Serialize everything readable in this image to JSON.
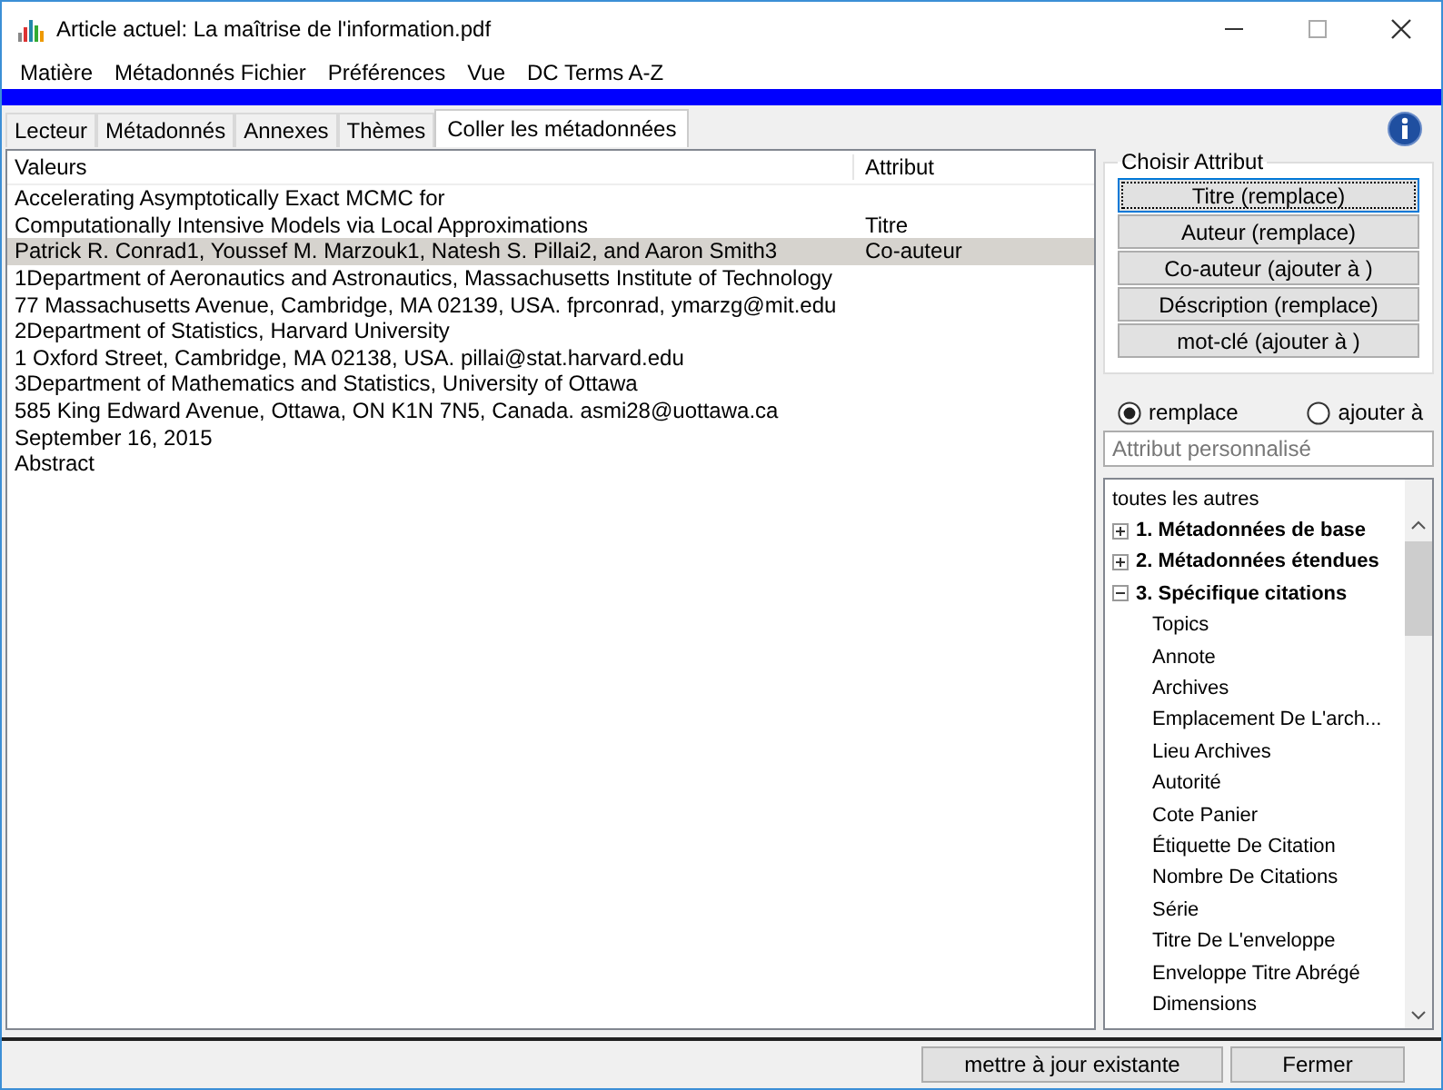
{
  "window": {
    "title": "Article actuel: La maîtrise de l'information.pdf"
  },
  "menu": [
    "Matière",
    "Métadonnés Fichier",
    "Préférences",
    "Vue",
    "DC Terms A-Z"
  ],
  "tabs": [
    {
      "label": "Lecteur",
      "selected": false
    },
    {
      "label": "Métadonnés",
      "selected": false
    },
    {
      "label": "Annexes",
      "selected": false
    },
    {
      "label": "Thèmes",
      "selected": false
    },
    {
      "label": "Coller les métadonnées",
      "selected": true
    }
  ],
  "table": {
    "columns": [
      "Valeurs",
      "Attribut"
    ],
    "rows": [
      {
        "value": "Accelerating Asymptotically Exact MCMC for",
        "selected": false
      },
      {
        "value": "Computationally Intensive Models via Local Approximations",
        "attribute": "Titre",
        "selected": false
      },
      {
        "value": "Patrick R. Conrad1, Youssef M. Marzouk1, Natesh S. Pillai2, and Aaron Smith3",
        "attribute": "Co-auteur",
        "selected": true
      },
      {
        "value": "1Department of Aeronautics and Astronautics, Massachusetts Institute of Technology",
        "selected": false
      },
      {
        "value": "77 Massachusetts Avenue, Cambridge, MA 02139, USA. fprconrad, ymarzg@mit.edu",
        "selected": false
      },
      {
        "value": "2Department of Statistics, Harvard University",
        "selected": false
      },
      {
        "value": "1 Oxford Street, Cambridge, MA 02138, USA. pillai@stat.harvard.edu",
        "selected": false
      },
      {
        "value": "3Department of Mathematics and Statistics, University of Ottawa",
        "selected": false
      },
      {
        "value": "585 King Edward Avenue, Ottawa, ON K1N 7N5, Canada. asmi28@uottawa.ca",
        "selected": false
      },
      {
        "value": "September 16, 2015",
        "selected": false
      },
      {
        "value": "Abstract",
        "selected": false
      }
    ]
  },
  "attribute_group": {
    "title": "Choisir Attribut",
    "buttons": [
      {
        "label": "Titre (remplace)",
        "selected": true
      },
      {
        "label": "Auteur (remplace)",
        "selected": false
      },
      {
        "label": "Co-auteur (ajouter à )",
        "selected": false
      },
      {
        "label": "Déscription (remplace)",
        "selected": false
      },
      {
        "label": "mot-clé (ajouter à )",
        "selected": false
      }
    ]
  },
  "mode": [
    {
      "label": "remplace",
      "selected": true
    },
    {
      "label": "ajouter à",
      "selected": false
    }
  ],
  "custom_attribute": {
    "placeholder": "Attribut personnalisé"
  },
  "tree": [
    {
      "label": "toutes les autres"
    },
    {
      "label": "1. Métadonnées de base",
      "expanded": false
    },
    {
      "label": "2. Métadonnées étendues",
      "expanded": false
    },
    {
      "label": "3. Spécifique citations",
      "expanded": true,
      "children": [
        {
          "label": "Topics"
        },
        {
          "label": "Annote"
        },
        {
          "label": "Archives"
        },
        {
          "label": "Emplacement De L'arch..."
        },
        {
          "label": "Lieu Archives"
        },
        {
          "label": "Autorité"
        },
        {
          "label": "Cote Panier"
        },
        {
          "label": "Étiquette De Citation"
        },
        {
          "label": "Nombre De Citations"
        },
        {
          "label": "Série"
        },
        {
          "label": "Titre De L'enveloppe"
        },
        {
          "label": "Enveloppe Titre Abrégé"
        },
        {
          "label": "Dimensions"
        }
      ]
    }
  ],
  "footer_buttons": [
    "mettre à jour existante",
    "Fermer"
  ]
}
